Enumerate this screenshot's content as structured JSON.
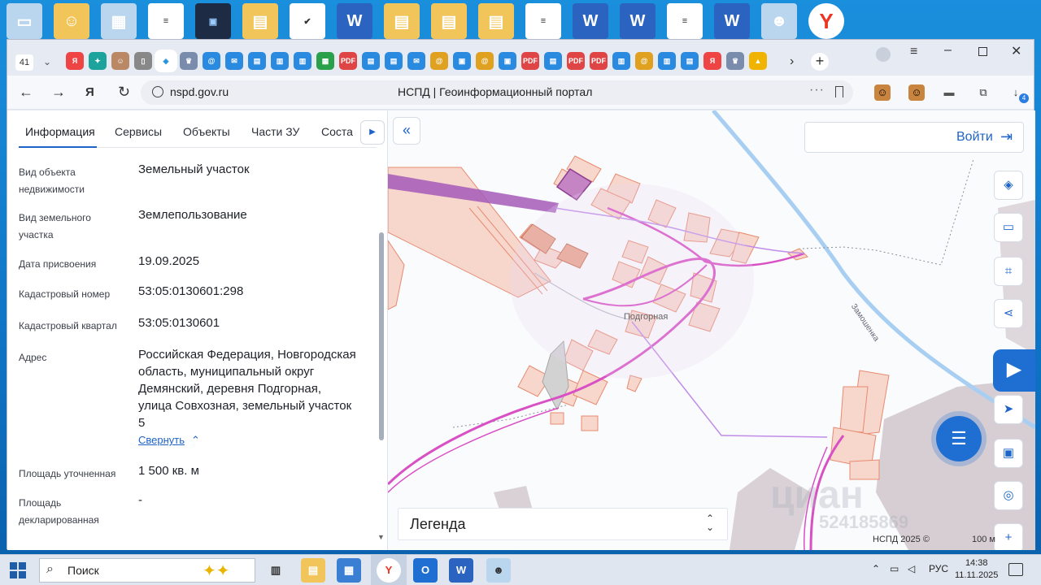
{
  "desktop": {
    "icons": [
      "computer-icon",
      "user-folder-icon",
      "presentation-icon",
      "document-icon",
      "media-icon",
      "folder-icon",
      "app-icon",
      "word-icon",
      "folder-icon",
      "folder-icon",
      "folder-icon",
      "document-icon",
      "word-icon",
      "word-icon",
      "document-icon",
      "word-icon",
      "avatar-icon",
      "yandex-icon"
    ]
  },
  "browser": {
    "tab_count": "41",
    "url": "nspd.gov.ru",
    "page_title": "НСПД | Геоинформационный портал",
    "downloads_badge": "4"
  },
  "panel": {
    "tabs": [
      "Информация",
      "Сервисы",
      "Объекты",
      "Части ЗУ",
      "Соста"
    ],
    "fields": [
      {
        "label": "Вид объекта недвижимости",
        "value": "Земельный участок"
      },
      {
        "label": "Вид земельного участка",
        "value": "Землепользование"
      },
      {
        "label": "Дата присвоения",
        "value": "19.09.2025"
      },
      {
        "label": "Кадастровый номер",
        "value": "53:05:0130601:298"
      },
      {
        "label": "Кадастровый квартал",
        "value": "53:05:0130601"
      },
      {
        "label": "Адрес",
        "value": "Российская Федерация, Новгородская область, муниципальный округ Демянский, деревня Подгорная, улица Совхозная, земельный участок 5"
      },
      {
        "label": "Площадь уточненная",
        "value": "1 500 кв. м"
      },
      {
        "label": "Площадь декларированная",
        "value": "-"
      }
    ],
    "collapse_link": "Свернуть"
  },
  "map": {
    "login_label": "Войти",
    "legend_label": "Легенда",
    "copyright": "НСПД 2025 ©",
    "scale_label": "100 м",
    "village_label": "Подгорная",
    "river_label": "Замошенка",
    "watermark_text": "циан",
    "watermark_number": "524185869",
    "colors": {
      "parcel_fill": "#f7d6cc",
      "parcel_stroke": "#e88a6f",
      "road_magenta": "#d94fc4",
      "road_lilac": "#c08ce8",
      "selected_parcel": "#a55ab8",
      "river": "#a8cff2",
      "territory_gray": "#cbbfc5",
      "accent": "#1e64c8"
    }
  },
  "taskbar": {
    "search_placeholder": "Поиск",
    "language": "РУС",
    "time": "14:38",
    "date": "11.11.2025"
  }
}
